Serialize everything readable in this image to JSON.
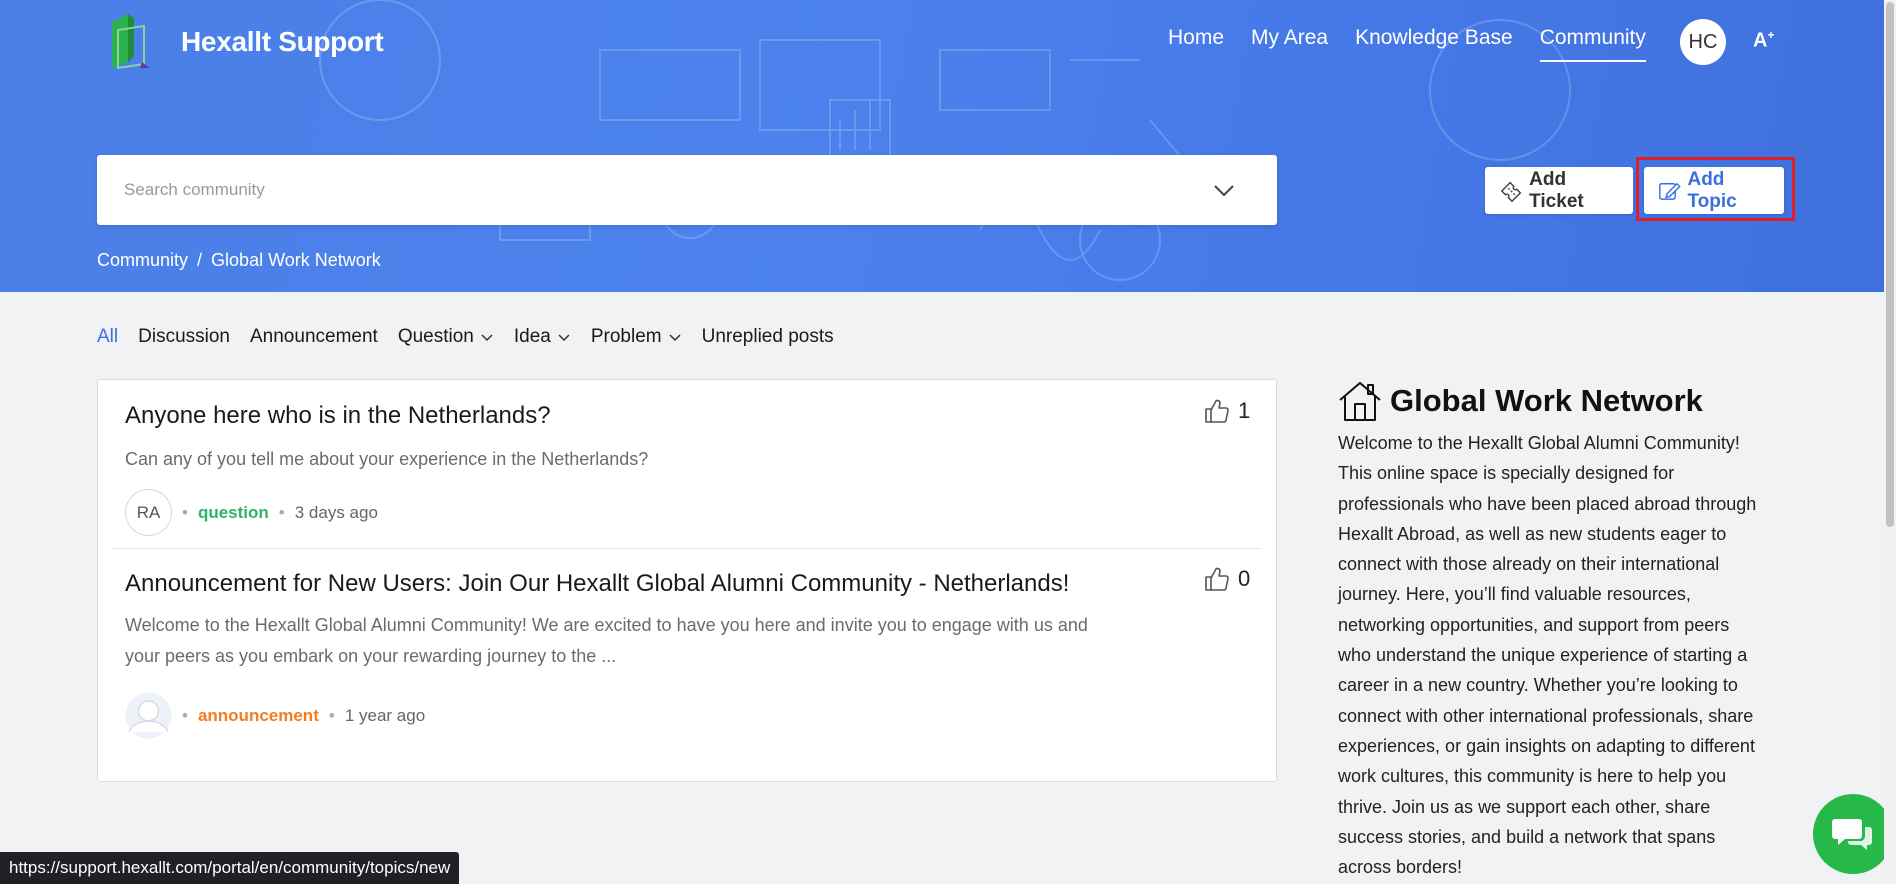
{
  "header": {
    "brand": "Hexallt Support",
    "nav": [
      {
        "label": "Home",
        "active": false
      },
      {
        "label": "My Area",
        "active": false
      },
      {
        "label": "Knowledge Base",
        "active": false
      },
      {
        "label": "Community",
        "active": true
      }
    ],
    "avatar_initials": "HC",
    "accessibility_label": "A",
    "accessibility_sup": "+"
  },
  "search": {
    "placeholder": "Search community"
  },
  "actions": {
    "add_ticket": "Add Ticket",
    "add_topic": "Add Topic"
  },
  "breadcrumb": {
    "root": "Community",
    "separator": "/",
    "current": "Global Work Network"
  },
  "filters": {
    "items": [
      {
        "label": "All",
        "active": true,
        "dropdown": false
      },
      {
        "label": "Discussion",
        "active": false,
        "dropdown": false
      },
      {
        "label": "Announcement",
        "active": false,
        "dropdown": false
      },
      {
        "label": "Question",
        "active": false,
        "dropdown": true
      },
      {
        "label": "Idea",
        "active": false,
        "dropdown": true
      },
      {
        "label": "Problem",
        "active": false,
        "dropdown": true
      },
      {
        "label": "Unreplied posts",
        "active": false,
        "dropdown": false
      }
    ]
  },
  "topics": [
    {
      "title": "Anyone here who is in the Netherlands?",
      "description": "Can any of you tell me about your experience in the Netherlands?",
      "likes": "1",
      "author_initials": "RA",
      "tag": "question",
      "time": "3 days ago"
    },
    {
      "title": "Announcement for New Users: Join Our Hexallt Global Alumni Community - Netherlands!",
      "description_line1": "Welcome to the Hexallt Global Alumni Community! We are excited to have you here and invite you to engage with us and",
      "description_line2": "your peers as you embark on your rewarding journey to the ...",
      "likes": "0",
      "tag": "announcement",
      "time": "1 year ago"
    }
  ],
  "sidebar": {
    "title": "Global Work Network",
    "text": "Welcome to the Hexallt Global Alumni Community! This online space is specially designed for professionals who have been placed abroad through Hexallt Abroad, as well as new students eager to connect with those already on their international journey. Here, you’ll find valuable resources, networking opportunities, and support from peers who understand the unique experience of starting a career in a new country. Whether you’re looking to connect with other international professionals, share experiences, or gain insights on adapting to different work cultures, this community is here to help you thrive. Join us as we support each other, share success stories, and build a network that spans across borders!"
  },
  "status_bar": {
    "url": "https://support.hexallt.com/portal/en/community/topics/new"
  },
  "colors": {
    "hero": "#4a7fe6",
    "accent": "#3a6fe0",
    "question_tag": "#2fb36a",
    "announcement_tag": "#f07d23",
    "chat_button": "#27b84a",
    "highlight": "#e01e2b"
  }
}
